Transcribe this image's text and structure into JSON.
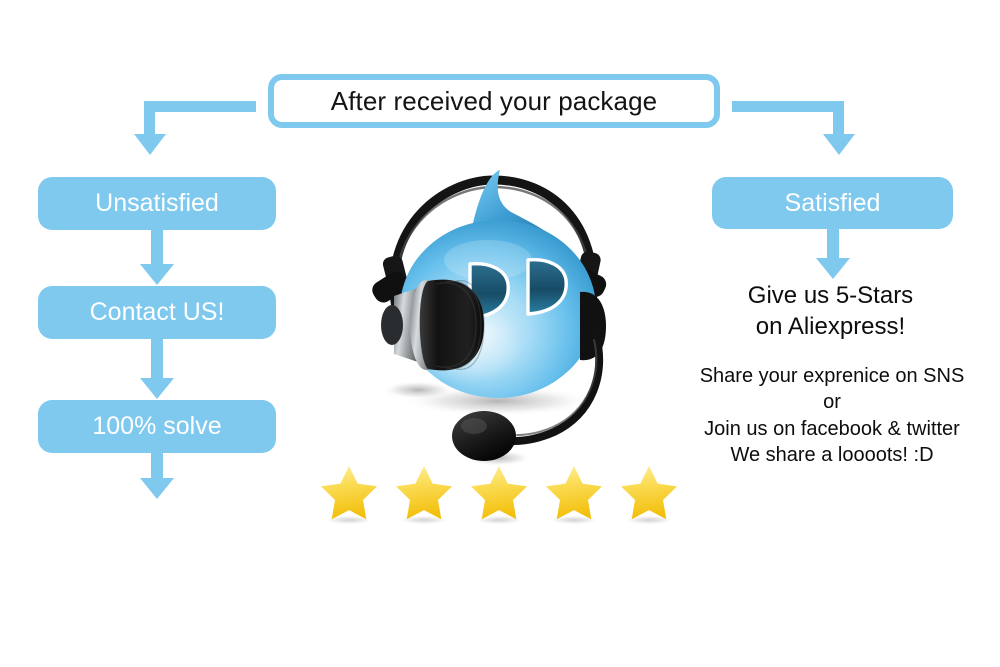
{
  "colors": {
    "accent_blue": "#7fc9ef",
    "text_dark": "#0d0d0d",
    "pill_text": "#ffffff",
    "star_gold": "#f5c518",
    "star_light": "#fbe87a",
    "mascot_blue": "#5bb7e8",
    "mascot_dark_blue": "#1d5f80",
    "headset_black": "#1c1c1c",
    "headset_silver": "#b9bcbe",
    "canvas": "#ffffff"
  },
  "header": {
    "title": "After received your package"
  },
  "left_branch": {
    "boxes": [
      {
        "label": "Unsatisfied"
      },
      {
        "label": "Contact US!"
      },
      {
        "label": "100% solve"
      }
    ]
  },
  "right_branch": {
    "box": {
      "label": "Satisfied"
    },
    "call_to_action": {
      "lines": [
        "Give us 5-Stars",
        "on Aliexpress!"
      ]
    },
    "social": {
      "lines": [
        "Share your exprenice on SNS",
        "or",
        "Join us on facebook & twitter",
        "We share a loooots! :D"
      ]
    }
  },
  "rating": {
    "star_count": 5,
    "stars": [
      {
        "name": "star-1"
      },
      {
        "name": "star-2"
      },
      {
        "name": "star-3"
      },
      {
        "name": "star-4"
      },
      {
        "name": "star-5"
      }
    ]
  },
  "mascot": {
    "description": "blue droplet customer-support character wearing a black headset with boom microphone"
  },
  "icons": {
    "arrow_down": "arrow-down-icon",
    "star": "star-icon",
    "headset": "headset-icon",
    "microphone": "microphone-icon"
  }
}
